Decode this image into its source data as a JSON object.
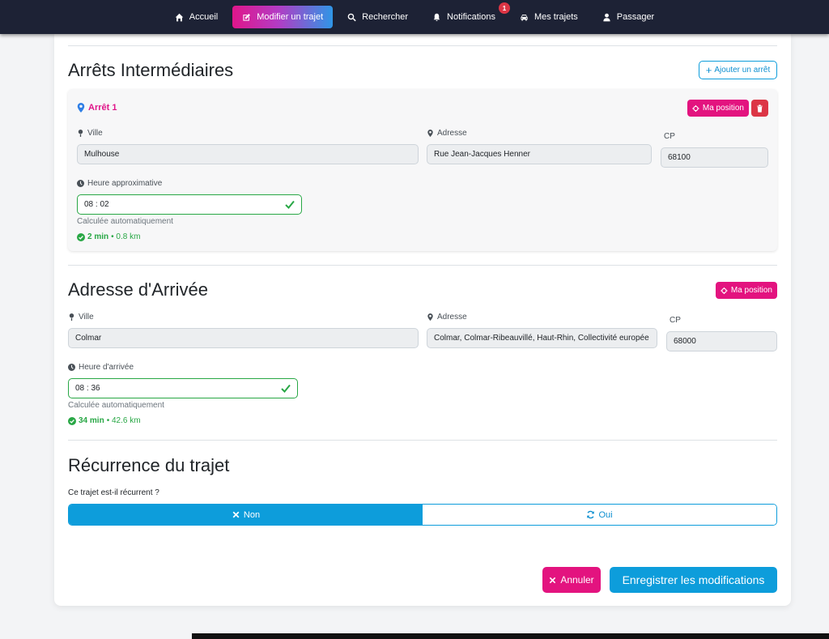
{
  "nav": {
    "items": [
      {
        "label": "Accueil",
        "icon": "home-icon"
      },
      {
        "label": "Modifier un trajet",
        "icon": "edit-icon",
        "active": true
      },
      {
        "label": "Rechercher",
        "icon": "search-icon"
      },
      {
        "label": "Notifications",
        "icon": "bell-icon",
        "badge": "1"
      },
      {
        "label": "Mes trajets",
        "icon": "car-icon"
      },
      {
        "label": "Passager",
        "icon": "user-icon"
      }
    ]
  },
  "stops": {
    "title": "Arrêts Intermédiaires",
    "add_label": "Ajouter un arrêt",
    "stop1": {
      "title": "Arrêt 1",
      "my_position_label": "Ma position",
      "city_label": "Ville",
      "city_value": "Mulhouse",
      "address_label": "Adresse",
      "address_value": "Rue Jean-Jacques Henner",
      "cp_label": "CP",
      "cp_value": "68100",
      "time_label": "Heure approximative",
      "time_value": "08 : 02",
      "auto_hint": "Calculée automatiquement",
      "duration": "2 min",
      "distance": "• 0.8 km"
    }
  },
  "arrival": {
    "title": "Adresse d'Arrivée",
    "my_position_label": "Ma position",
    "city_label": "Ville",
    "city_value": "Colmar",
    "address_label": "Adresse",
    "address_value": "Colmar, Colmar-Ribeauvillé, Haut-Rhin, Collectivité europée",
    "cp_label": "CP",
    "cp_value": "68000",
    "time_label": "Heure d'arrivée",
    "time_value": "08 : 36",
    "auto_hint": "Calculée automatiquement",
    "duration": "34 min",
    "distance": "• 42.6 km"
  },
  "recurrence": {
    "title": "Récurrence du trajet",
    "question": "Ce trajet est-il récurrent ?",
    "no_label": "Non",
    "yes_label": "Oui",
    "selected": "Non"
  },
  "actions": {
    "cancel_label": "Annuler",
    "save_label": "Enregistrer les modifications"
  },
  "colors": {
    "nav_bg": "#1d2235",
    "pink": "#e3137f",
    "blue": "#0d9ddb",
    "green": "#28a745",
    "red": "#dc3545"
  }
}
